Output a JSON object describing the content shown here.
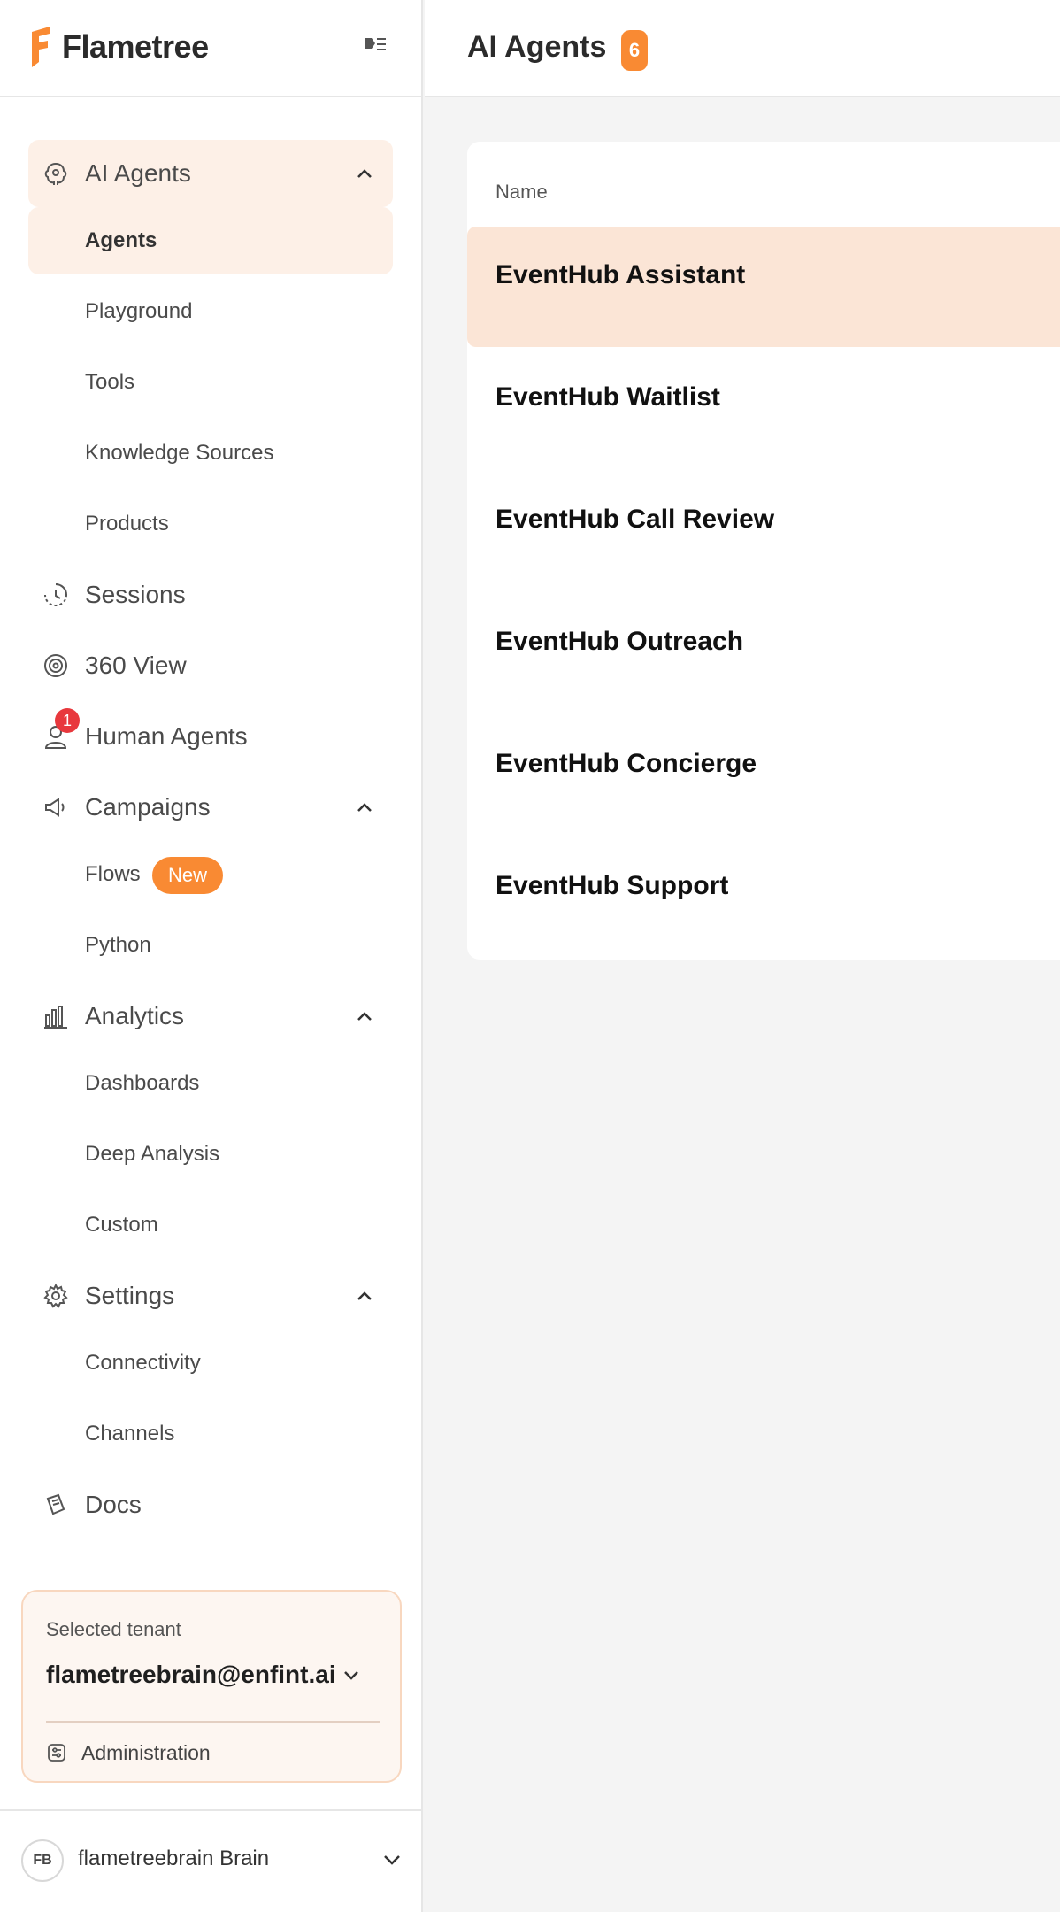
{
  "brand": {
    "name": "Flametree",
    "accent": "#f98a33"
  },
  "sidebar": {
    "items": [
      {
        "label": "AI Agents",
        "icon": "brain-icon",
        "expanded": true,
        "children": [
          {
            "label": "Agents",
            "active": true
          },
          {
            "label": "Playground"
          },
          {
            "label": "Tools"
          },
          {
            "label": "Knowledge Sources"
          },
          {
            "label": "Products"
          }
        ]
      },
      {
        "label": "Sessions",
        "icon": "history-clock-icon"
      },
      {
        "label": "360 View",
        "icon": "spiral-icon"
      },
      {
        "label": "Human Agents",
        "icon": "user-icon",
        "badge": "1"
      },
      {
        "label": "Campaigns",
        "icon": "megaphone-icon",
        "expanded": true,
        "children": [
          {
            "label": "Flows",
            "pill": "New"
          },
          {
            "label": "Python"
          }
        ]
      },
      {
        "label": "Analytics",
        "icon": "bar-chart-icon",
        "expanded": true,
        "children": [
          {
            "label": "Dashboards"
          },
          {
            "label": "Deep Analysis"
          },
          {
            "label": "Custom"
          }
        ]
      },
      {
        "label": "Settings",
        "icon": "gear-icon",
        "expanded": true,
        "children": [
          {
            "label": "Connectivity"
          },
          {
            "label": "Channels"
          }
        ]
      },
      {
        "label": "Docs",
        "icon": "docs-icon"
      }
    ]
  },
  "tenant": {
    "label": "Selected tenant",
    "value": "flametreebrain@enfint.ai",
    "admin_label": "Administration"
  },
  "user": {
    "initials": "FB",
    "name": "flametreebrain Brain"
  },
  "main": {
    "title": "AI Agents",
    "count": "6",
    "table": {
      "column_header": "Name",
      "rows": [
        {
          "name": "EventHub Assistant",
          "selected": true
        },
        {
          "name": "EventHub Waitlist"
        },
        {
          "name": "EventHub Call Review"
        },
        {
          "name": "EventHub Outreach"
        },
        {
          "name": "EventHub Concierge"
        },
        {
          "name": "EventHub Support"
        }
      ]
    }
  }
}
